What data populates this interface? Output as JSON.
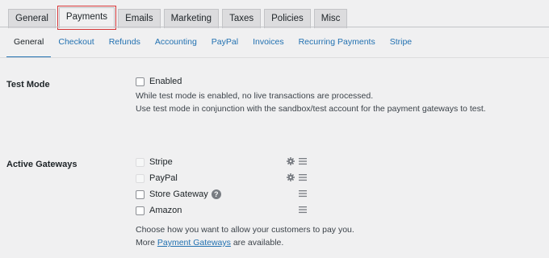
{
  "main_tabs": [
    {
      "label": "General"
    },
    {
      "label": "Payments"
    },
    {
      "label": "Emails"
    },
    {
      "label": "Marketing"
    },
    {
      "label": "Taxes"
    },
    {
      "label": "Policies"
    },
    {
      "label": "Misc"
    }
  ],
  "sub_tabs": [
    {
      "label": "General"
    },
    {
      "label": "Checkout"
    },
    {
      "label": "Refunds"
    },
    {
      "label": "Accounting"
    },
    {
      "label": "PayPal"
    },
    {
      "label": "Invoices"
    },
    {
      "label": "Recurring Payments"
    },
    {
      "label": "Stripe"
    }
  ],
  "test_mode": {
    "label": "Test Mode",
    "checkbox_label": "Enabled",
    "desc_line1": "While test mode is enabled, no live transactions are processed.",
    "desc_line2": "Use test mode in conjunction with the sandbox/test account for the payment gateways to test."
  },
  "active_gateways": {
    "label": "Active Gateways",
    "items": [
      {
        "label": "Stripe"
      },
      {
        "label": "PayPal"
      },
      {
        "label": "Store Gateway",
        "help": "?"
      },
      {
        "label": "Amazon"
      }
    ],
    "desc_line1": "Choose how you want to allow your customers to pay you.",
    "desc_more": "More",
    "desc_link": "Payment Gateways",
    "desc_tail": "are available."
  },
  "colors": {
    "link": "#2271b1",
    "highlight": "#d63638",
    "background": "#f0f0f1"
  }
}
